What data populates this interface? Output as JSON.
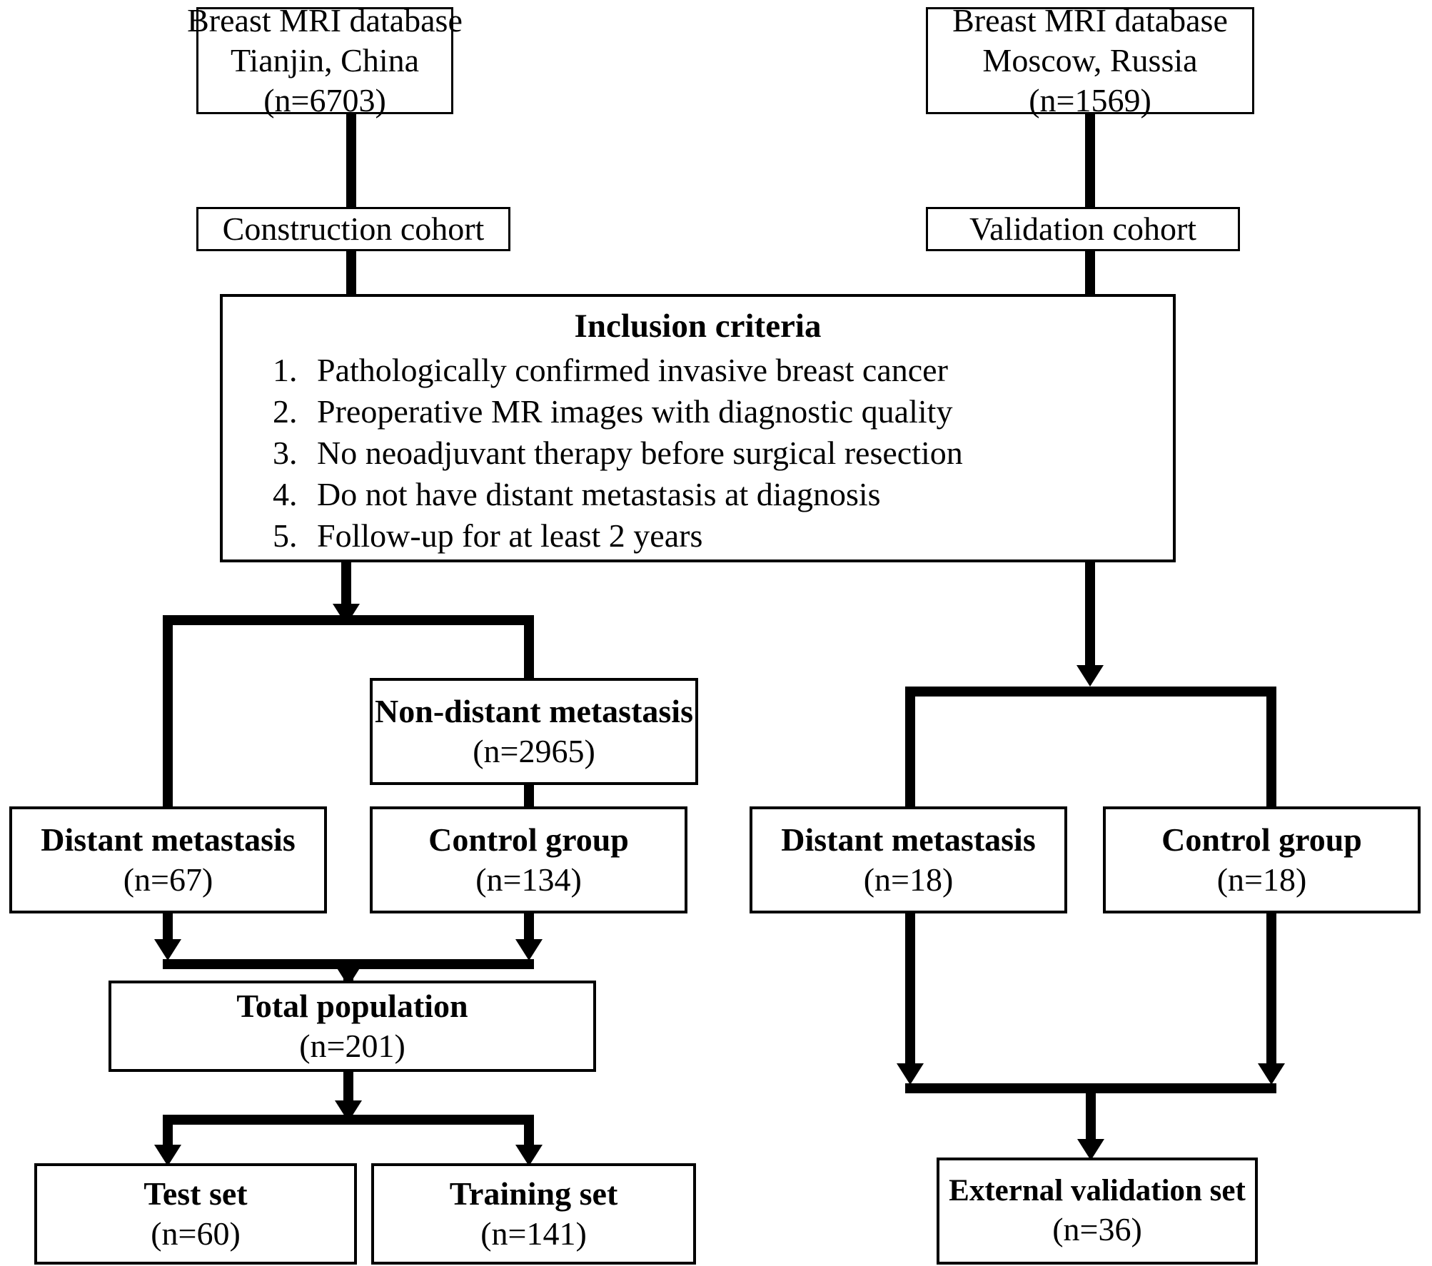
{
  "diagram": {
    "title": "Study population flow diagram",
    "line_color": "#000000",
    "box_border_color": "#000000",
    "background": "#ffffff"
  },
  "sources": {
    "left": {
      "line1": "Breast MRI database",
      "line2": "Tianjin, China",
      "count": "(n=6703)"
    },
    "right": {
      "line1": "Breast MRI database",
      "line2": "Moscow, Russia",
      "count": "(n=1569)"
    }
  },
  "cohorts": {
    "construction": "Construction cohort",
    "validation": "Validation cohort"
  },
  "criteria": {
    "title": "Inclusion criteria",
    "items": [
      {
        "index": "1.",
        "text": "Pathologically confirmed invasive breast cancer"
      },
      {
        "index": "2.",
        "text": "Preoperative MR images with diagnostic quality"
      },
      {
        "index": "3.",
        "text": "No neoadjuvant therapy before surgical resection"
      },
      {
        "index": "4.",
        "text": "Do not have distant metastasis at diagnosis"
      },
      {
        "index": "5.",
        "text": "Follow-up for at least 2 years"
      }
    ]
  },
  "construction_branch": {
    "non_distant_metastasis": {
      "label": "Non-distant metastasis",
      "count": "(n=2965)"
    },
    "distant_metastasis": {
      "label": "Distant metastasis",
      "count": "(n=67)"
    },
    "control_group": {
      "label": "Control group",
      "count": "(n=134)"
    },
    "total_population": {
      "label": "Total population",
      "count": "(n=201)"
    },
    "test_set": {
      "label": "Test set",
      "count": "(n=60)"
    },
    "training_set": {
      "label": "Training set",
      "count": "(n=141)"
    }
  },
  "validation_branch": {
    "distant_metastasis": {
      "label": "Distant metastasis",
      "count": "(n=18)"
    },
    "control_group": {
      "label": "Control group",
      "count": "(n=18)"
    },
    "external_validation_set": {
      "label": "External validation set",
      "count": "(n=36)"
    }
  }
}
